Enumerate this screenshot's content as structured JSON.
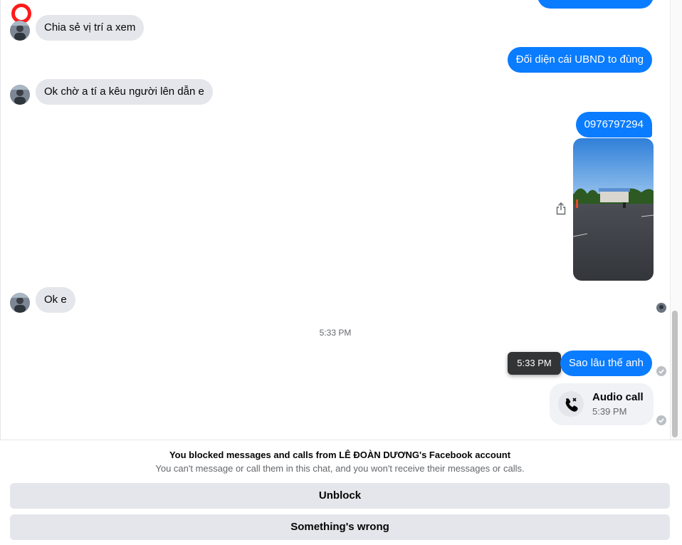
{
  "messages": {
    "incoming": [
      {
        "text": "Chia sẻ vị trí a xem"
      },
      {
        "text": "Ok chờ a tí a kêu người lên dẫn e"
      },
      {
        "text": "Ok e"
      }
    ],
    "outgoing": [
      {
        "text": "Đối diện cái UBND to đùng"
      },
      {
        "text": "0976797294"
      },
      {
        "text": "Sao lâu thế anh"
      }
    ]
  },
  "timestamp_divider": "5:33 PM",
  "tooltip_time": "5:33 PM",
  "call": {
    "title": "Audio call",
    "time": "5:39 PM"
  },
  "footer": {
    "block_title": "You blocked messages and calls from LÊ ĐOÀN DƯƠNG's Facebook account",
    "block_subtitle": "You can't message or call them in this chat, and you won't receive their messages or calls.",
    "unblock_label": "Unblock",
    "wrong_label": "Something's wrong"
  },
  "colors": {
    "outgoing_bubble": "#0a7cff",
    "incoming_bubble": "#e4e6eb",
    "record_indicator": "#ff1a1a"
  }
}
